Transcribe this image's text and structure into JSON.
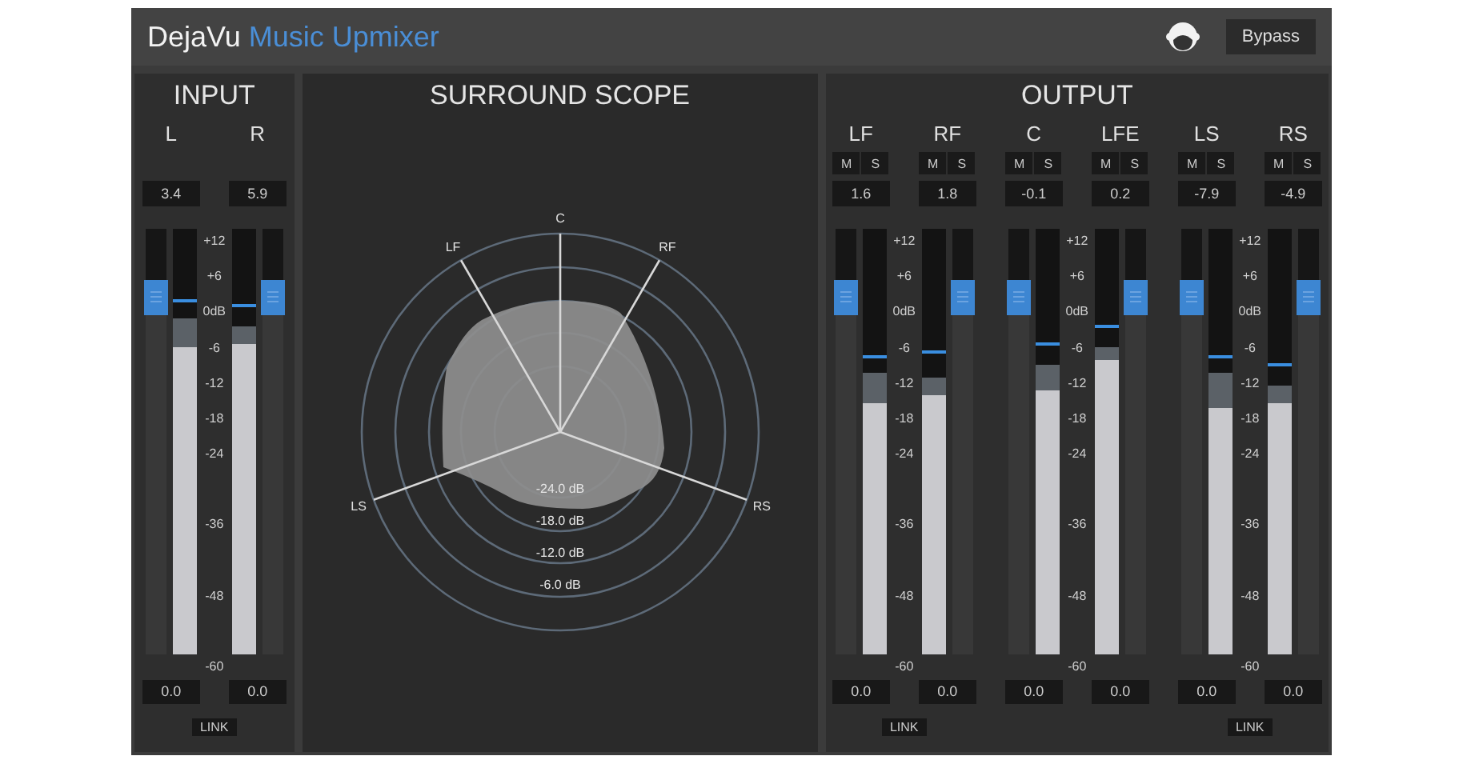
{
  "header": {
    "brand": "DejaVu",
    "product": "Music Upmixer",
    "bypass": "Bypass"
  },
  "input": {
    "title": "INPUT",
    "pairs": [
      {
        "scale": [
          "+12",
          "+6",
          "0dB",
          "-6",
          "-12",
          "-18",
          "-24",
          "-36",
          "-48",
          "-60"
        ],
        "link": "LINK",
        "channels": [
          {
            "name": "L",
            "readout": "3.4",
            "gain": "0.0",
            "fader": {
              "level": 0.84
            },
            "meter": {
              "level": 0.72
            },
            "hold": {
              "level": 0.79
            },
            "peak": {
              "level": 0.83
            }
          },
          {
            "name": "R",
            "readout": "5.9",
            "gain": "0.0",
            "fader": {
              "level": 0.84
            },
            "meter": {
              "level": 0.73
            },
            "hold": {
              "level": 0.77
            },
            "peak": {
              "level": 0.82
            }
          }
        ]
      }
    ]
  },
  "scope": {
    "title": "SURROUND SCOPE",
    "axes": [
      "C",
      "LF",
      "RF",
      "LS",
      "RS"
    ],
    "rings": [
      "-24.0 dB",
      "-18.0 dB",
      "-12.0 dB",
      "-6.0 dB"
    ]
  },
  "output": {
    "title": "OUTPUT",
    "pairs": [
      {
        "scale": [
          "+12",
          "+6",
          "0dB",
          "-6",
          "-12",
          "-18",
          "-24",
          "-36",
          "-48",
          "-60"
        ],
        "link": "LINK",
        "channels": [
          {
            "name": "LF",
            "mute": "M",
            "solo": "S",
            "readout": "1.6",
            "gain": "0.0",
            "fader": {
              "level": 0.84
            },
            "meter": {
              "level": 0.59
            },
            "hold": {
              "level": 0.66
            },
            "peak": {
              "level": 0.7
            }
          },
          {
            "name": "RF",
            "mute": "M",
            "solo": "S",
            "readout": "1.8",
            "gain": "0.0",
            "fader": {
              "level": 0.84
            },
            "meter": {
              "level": 0.61
            },
            "hold": {
              "level": 0.65
            },
            "peak": {
              "level": 0.71
            }
          }
        ]
      },
      {
        "scale": [
          "+12",
          "+6",
          "0dB",
          "-6",
          "-12",
          "-18",
          "-24",
          "-36",
          "-48",
          "-60"
        ],
        "channels": [
          {
            "name": "C",
            "mute": "M",
            "solo": "S",
            "readout": "-0.1",
            "gain": "0.0",
            "fader": {
              "level": 0.84
            },
            "meter": {
              "level": 0.62
            },
            "hold": {
              "level": 0.68
            },
            "peak": {
              "level": 0.73
            }
          },
          {
            "name": "LFE",
            "mute": "M",
            "solo": "S",
            "readout": "0.2",
            "gain": "0.0",
            "fader": {
              "level": 0.84
            },
            "meter": {
              "level": 0.69
            },
            "hold": {
              "level": 0.72
            },
            "peak": {
              "level": 0.77
            }
          }
        ]
      },
      {
        "scale": [
          "+12",
          "+6",
          "0dB",
          "-6",
          "-12",
          "-18",
          "-24",
          "-36",
          "-48",
          "-60"
        ],
        "link": "LINK",
        "channels": [
          {
            "name": "LS",
            "mute": "M",
            "solo": "S",
            "readout": "-7.9",
            "gain": "0.0",
            "fader": {
              "level": 0.84
            },
            "meter": {
              "level": 0.58
            },
            "hold": {
              "level": 0.66
            },
            "peak": {
              "level": 0.7
            }
          },
          {
            "name": "RS",
            "mute": "M",
            "solo": "S",
            "readout": "-4.9",
            "gain": "0.0",
            "fader": {
              "level": 0.84
            },
            "meter": {
              "level": 0.59
            },
            "hold": {
              "level": 0.63
            },
            "peak": {
              "level": 0.68
            }
          }
        ]
      }
    ]
  }
}
